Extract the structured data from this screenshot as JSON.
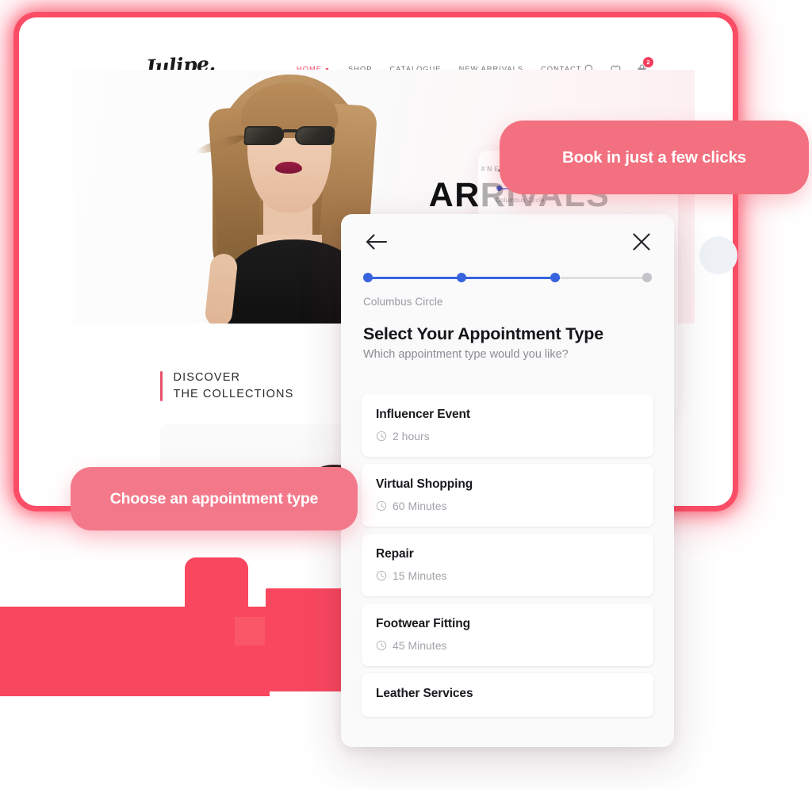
{
  "site": {
    "brand": "Julipe.",
    "nav": [
      {
        "label": "HOME",
        "active": true,
        "has_caret": true
      },
      {
        "label": "SHOP",
        "active": false,
        "has_caret": false
      },
      {
        "label": "CATALOGUE",
        "active": false,
        "has_caret": false
      },
      {
        "label": "NEW ARRIVALS",
        "active": false,
        "has_caret": false
      },
      {
        "label": "CONTACT",
        "active": false,
        "has_caret": false
      }
    ],
    "actions": {
      "search_icon": "search-icon",
      "wishlist_icon": "heart-icon",
      "cart_icon": "shopping-bag-icon",
      "cart_badge": "2"
    },
    "hero": {
      "eyebrow": "#NEW SUMMER",
      "title": "ARRIVALS"
    },
    "discover": {
      "line1": "DISCOVER",
      "line2": "THE COLLECTIONS"
    }
  },
  "ghost_modal": {
    "back_icon": "arrow-left-icon",
    "location": "Columbus Circle"
  },
  "modal": {
    "back_icon": "arrow-left-icon",
    "close_icon": "close-icon",
    "location": "Columbus Circle",
    "title": "Select Your Appointment Type",
    "subtitle": "Which appointment type would you like?",
    "stepper": {
      "total_steps": 4,
      "completed_steps": 3,
      "active_color": "#3863de",
      "inactive_color": "#c3c3ca"
    },
    "appointments": [
      {
        "name": "Influencer Event",
        "duration": "2 hours",
        "clock_icon": "clock-icon"
      },
      {
        "name": "Virtual Shopping",
        "duration": "60 Minutes",
        "clock_icon": "clock-icon"
      },
      {
        "name": "Repair",
        "duration": "15 Minutes",
        "clock_icon": "clock-icon"
      },
      {
        "name": "Footwear Fitting",
        "duration": "45 Minutes",
        "clock_icon": "clock-icon"
      },
      {
        "name": "Leather Services",
        "duration": "",
        "clock_icon": ""
      }
    ]
  },
  "callouts": {
    "book": "Book in just a few clicks",
    "choose": "Choose an appointment type"
  },
  "colors": {
    "brand_pink": "#fb4d66",
    "callout_pink": "#f2707f",
    "accent_blue": "#3863de",
    "nav_active": "#ef4f6b"
  }
}
